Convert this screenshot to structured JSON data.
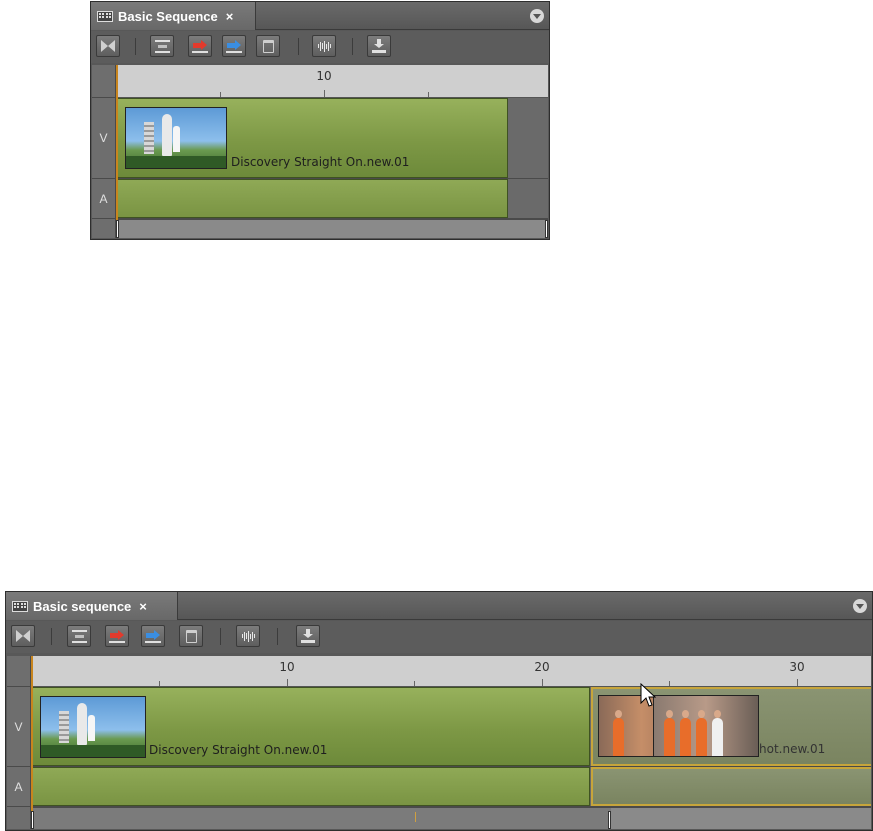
{
  "panel_top": {
    "tab_title": "Basic Sequence",
    "close_glyph": "×",
    "ruler_labels": [
      "10"
    ],
    "tracks": [
      "V",
      "A"
    ],
    "clip_name": "Discovery Straight On.new.01"
  },
  "panel_bottom": {
    "tab_title": "Basic sequence",
    "close_glyph": "×",
    "ruler_labels": [
      "10",
      "20",
      "30"
    ],
    "tracks": [
      "V",
      "A"
    ],
    "clip_name": "Discovery Straight On.new.01",
    "ghost_clip_name": "hot.new.01"
  },
  "toolbar_icons": [
    "add-edit-icon",
    "splice-in-icon",
    "overwrite-icon",
    "replace-icon",
    "delete-icon",
    "audio-waveform-icon",
    "export-icon"
  ],
  "colors": {
    "clip_green": "#86a04c",
    "ghost_outline": "#c7a53b",
    "playhead": "#c8851e",
    "panel_bg": "#585858"
  }
}
